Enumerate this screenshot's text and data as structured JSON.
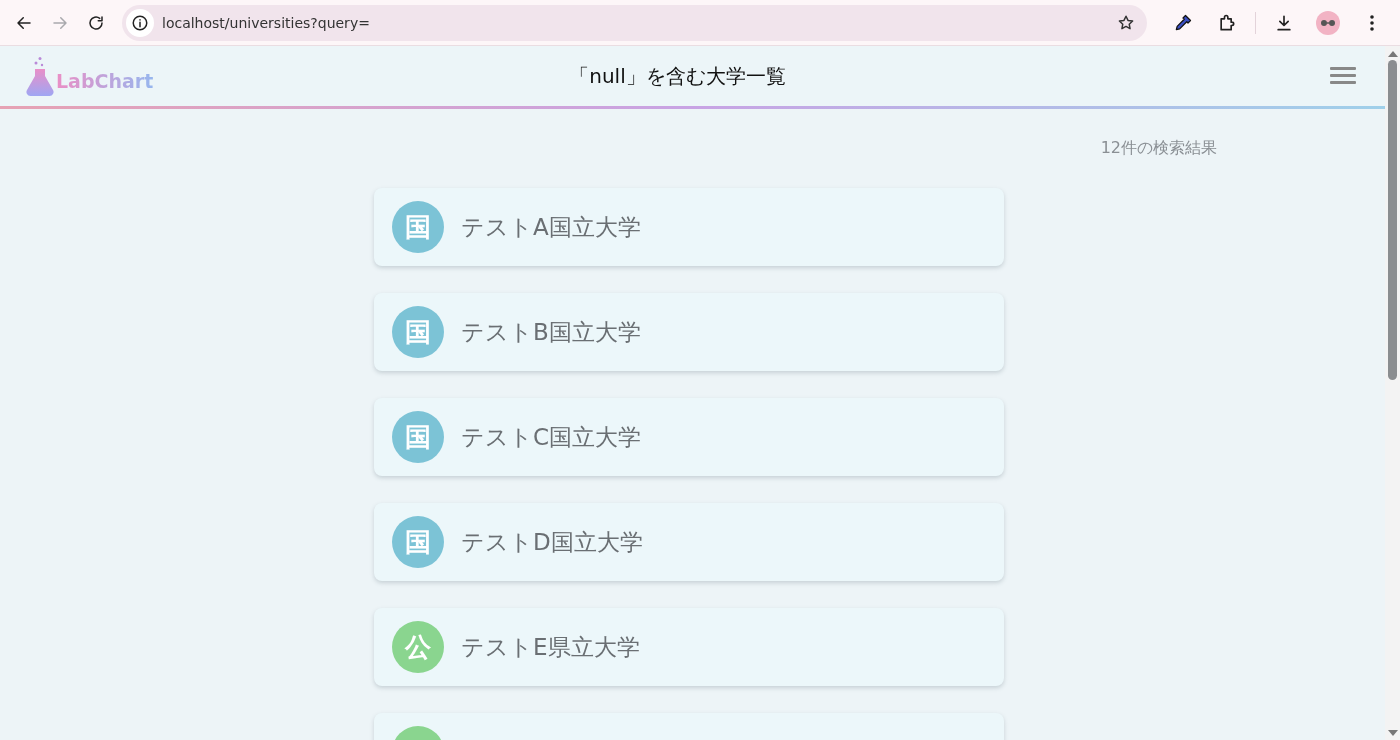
{
  "browser": {
    "nav_buttons": [
      {
        "kind": "back",
        "disabled": false
      },
      {
        "kind": "forward",
        "disabled": true
      },
      {
        "kind": "reload",
        "disabled": false
      }
    ],
    "url": "localhost/universities?query="
  },
  "header": {
    "logo": "LabChart",
    "title": "「null」を含む大学一覧"
  },
  "result_count": "12件の検索結果",
  "universities": [
    {
      "kind": "national",
      "badge": "国",
      "name": "テストA国立大学"
    },
    {
      "kind": "national",
      "badge": "国",
      "name": "テストB国立大学"
    },
    {
      "kind": "national",
      "badge": "国",
      "name": "テストC国立大学"
    },
    {
      "kind": "national",
      "badge": "国",
      "name": "テストD国立大学"
    },
    {
      "kind": "public",
      "badge": "公",
      "name": "テストE県立大学"
    },
    {
      "kind": "public"
    }
  ]
}
